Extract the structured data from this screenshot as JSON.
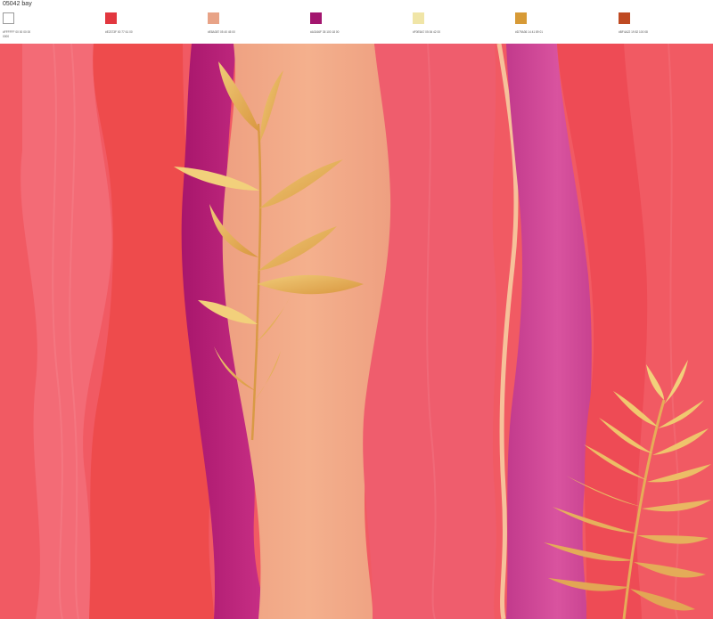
{
  "header": {
    "title": "05042 bay",
    "swatches": [
      {
        "color": "#ffffff",
        "label": "#FFFFFF 00 00 00 00",
        "sub": "0000"
      },
      {
        "color": "#e2373f",
        "label": "#E2373F 00 77 61 00",
        "sub": ""
      },
      {
        "color": "#e8a387",
        "label": "#E8A387 05 40 45 00",
        "sub": ""
      },
      {
        "color": "#a3166f",
        "label": "#A3166F 35 100 18 00",
        "sub": ""
      },
      {
        "color": "#f0e5a7",
        "label": "#F0E5A7 05 06 42 00",
        "sub": ""
      },
      {
        "color": "#d79a36",
        "label": "#D79A36 14 41 89 01",
        "sub": ""
      },
      {
        "color": "#bf4a22",
        "label": "#BF4A22 19 82 100 08",
        "sub": ""
      }
    ]
  },
  "artwork": {
    "name": "tropical-waves-pattern",
    "colors": {
      "coral": "#f15a63",
      "coral_light": "#f56a74",
      "red": "#ed4a4e",
      "magenta": "#b8237a",
      "pink": "#d24c9a",
      "peach": "#f2ab87",
      "rose": "#ef5e6d",
      "gold": "#e2a34c",
      "gold_light": "#f2d07b"
    }
  }
}
